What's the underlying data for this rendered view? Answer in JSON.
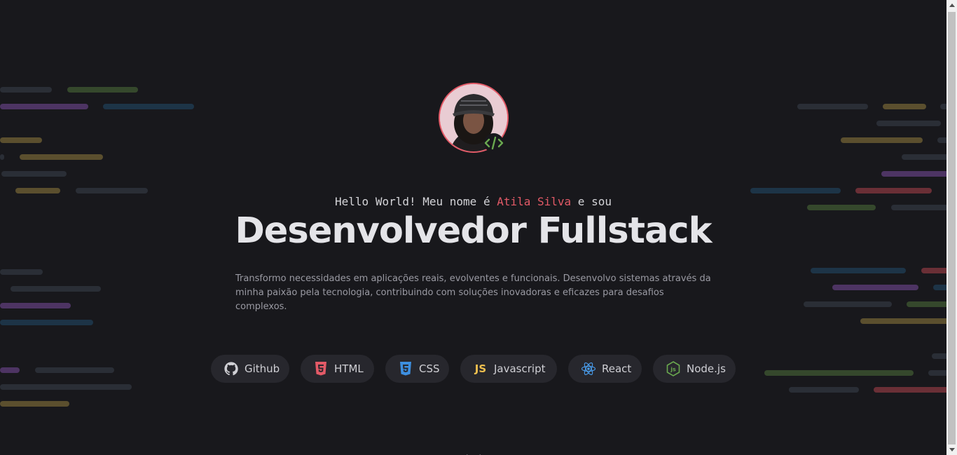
{
  "hero": {
    "greeting_prefix": "Hello World! Meu nome é ",
    "name": "Atila Silva",
    "greeting_suffix": " e sou",
    "headline": "Desenvolvedor Fullstack",
    "description_line1": "Transformo necessidades em aplicações reais, evolventes e funcionais. Desenvolvo sistemas através da",
    "description_line2": "minha paixão pela tecnologia, contribuindo com soluções inovadoras e eficazes para desafios complexos."
  },
  "tech_chips": [
    {
      "label": "Github",
      "icon": "github-icon"
    },
    {
      "label": "HTML",
      "icon": "html5-icon"
    },
    {
      "label": "CSS",
      "icon": "css3-icon"
    },
    {
      "label": "Javascript",
      "icon": "js-icon",
      "icon_text": "JS"
    },
    {
      "label": "React",
      "icon": "react-icon"
    },
    {
      "label": "Node.js",
      "icon": "nodejs-icon"
    }
  ],
  "colors": {
    "background": "#18181c",
    "accent": "#e35a67",
    "chip_bg": "#27272d",
    "html": "#e44d26",
    "css": "#2965f1",
    "js": "#f0c04f",
    "react": "#61dafb",
    "node": "#6aa84f"
  },
  "avatar_badge_icon": "code-brackets-icon"
}
